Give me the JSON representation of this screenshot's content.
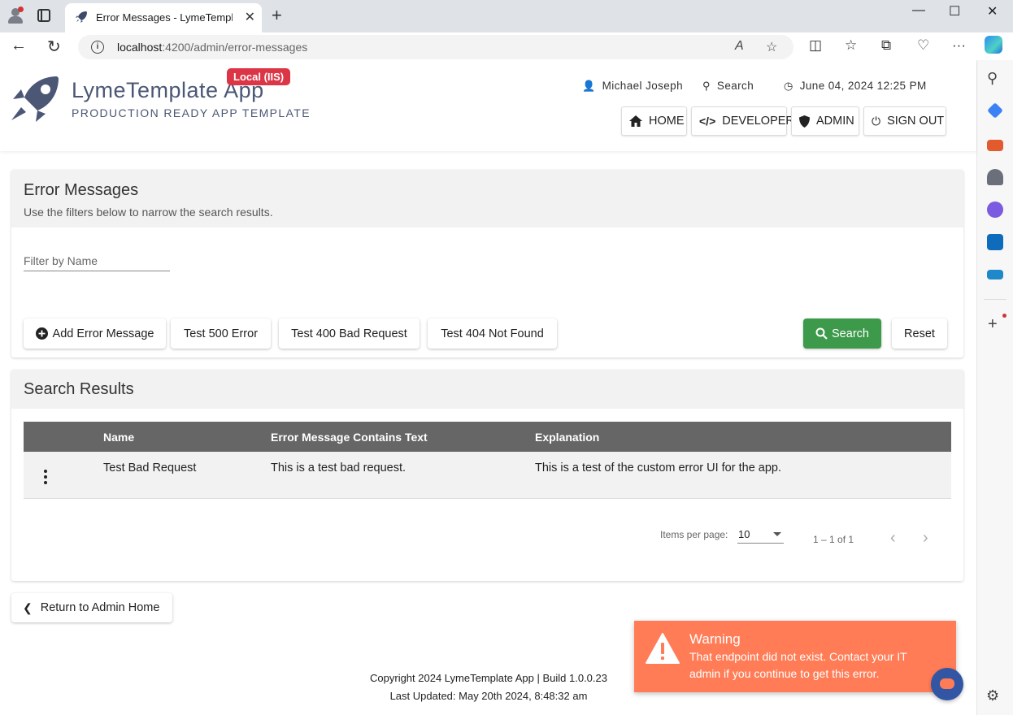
{
  "browser": {
    "tab_title": "Error Messages - LymeTemplate App",
    "tab_close": "✕",
    "new_tab": "+",
    "url_host": "localhost",
    "url_path": ":4200/admin/error-messages",
    "window_controls": {
      "minimize": "—",
      "maximize": "☐",
      "close": "✕"
    },
    "read_aloud": "A",
    "more_menu": "···"
  },
  "header": {
    "app_name": "LymeTemplate App",
    "app_subtitle": "PRODUCTION READY APP TEMPLATE",
    "env_badge": "Local (IIS)",
    "user_name": "Michael Joseph",
    "search_label": "Search",
    "datetime": "June 04, 2024 12:25 PM",
    "nav": [
      {
        "label": "HOME",
        "icon": "home-icon"
      },
      {
        "label": "DEVELOPER",
        "icon": "code-icon"
      },
      {
        "label": "ADMIN",
        "icon": "shield-icon"
      },
      {
        "label": "SIGN OUT",
        "icon": "power-icon"
      }
    ]
  },
  "filters_card": {
    "title": "Error Messages",
    "subtitle": "Use the filters below to narrow the search results.",
    "filter_placeholder": "Filter by Name",
    "buttons": {
      "add": "Add Error Message",
      "test500": "Test 500 Error",
      "test400": "Test 400 Bad Request",
      "test404": "Test 404 Not Found",
      "search": "Search",
      "reset": "Reset"
    }
  },
  "results_card": {
    "title": "Search Results",
    "columns": [
      "Name",
      "Error Message Contains Text",
      "Explanation"
    ],
    "rows": [
      {
        "name": "Test Bad Request",
        "contains": "This is a test bad request.",
        "explanation": "This is a test of the custom error UI for the app."
      }
    ],
    "pager": {
      "items_per_page_label": "Items per page:",
      "items_per_page": "10",
      "range": "1 – 1 of 1",
      "prev": "‹",
      "next": "›"
    }
  },
  "back_button": "Return to Admin Home",
  "footer": {
    "line1": "Copyright 2024 LymeTemplate App | Build 1.0.0.23",
    "line2": "Last Updated: May 20th 2024, 8:48:32 am"
  },
  "toast": {
    "title": "Warning",
    "message": "That endpoint did not exist. Contact your IT admin if you continue to get this error."
  },
  "colors": {
    "brand_text": "#4b5775",
    "badge": "#dc3545",
    "search_button": "#3c9a4a",
    "table_header": "#666666",
    "toast": "#ff7c56"
  }
}
